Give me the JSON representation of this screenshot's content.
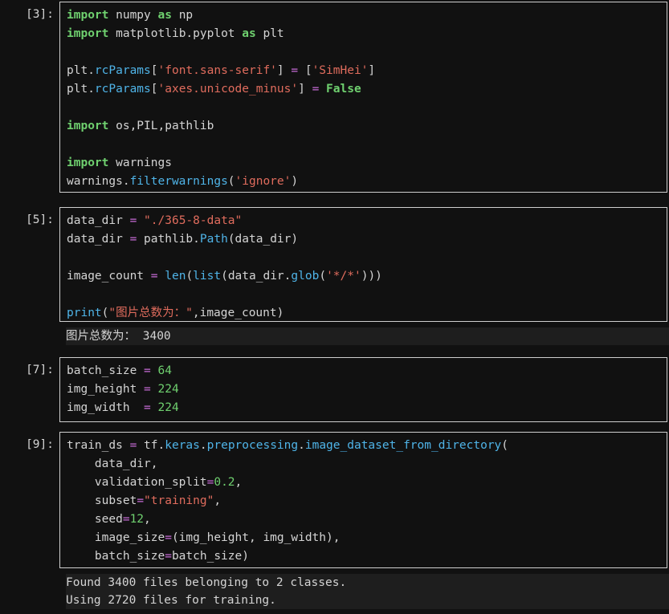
{
  "cells": [
    {
      "prompt": "[3]:",
      "lines": [
        [
          [
            "kw",
            "import"
          ],
          [
            "tx",
            " numpy "
          ],
          [
            "kw",
            "as"
          ],
          [
            "tx",
            " np"
          ]
        ],
        [
          [
            "kw",
            "import"
          ],
          [
            "tx",
            " matplotlib.pyplot "
          ],
          [
            "kw",
            "as"
          ],
          [
            "tx",
            " plt"
          ]
        ],
        [],
        [
          [
            "tx",
            "plt."
          ],
          [
            "fn",
            "rcParams"
          ],
          [
            "tx",
            "["
          ],
          [
            "str",
            "'font.sans-serif'"
          ],
          [
            "tx",
            "] "
          ],
          [
            "op",
            "="
          ],
          [
            "tx",
            " ["
          ],
          [
            "str",
            "'SimHei'"
          ],
          [
            "tx",
            "]"
          ]
        ],
        [
          [
            "tx",
            "plt."
          ],
          [
            "fn",
            "rcParams"
          ],
          [
            "tx",
            "["
          ],
          [
            "str",
            "'axes.unicode_minus'"
          ],
          [
            "tx",
            "] "
          ],
          [
            "op",
            "="
          ],
          [
            "tx",
            " "
          ],
          [
            "bool",
            "False"
          ]
        ],
        [],
        [
          [
            "kw",
            "import"
          ],
          [
            "tx",
            " os,PIL,pathlib"
          ]
        ],
        [],
        [
          [
            "kw",
            "import"
          ],
          [
            "tx",
            " warnings"
          ]
        ],
        [
          [
            "tx",
            "warnings."
          ],
          [
            "fn",
            "filterwarnings"
          ],
          [
            "tx",
            "("
          ],
          [
            "str",
            "'ignore'"
          ],
          [
            "tx",
            ")"
          ]
        ]
      ],
      "output": []
    },
    {
      "prompt": "[5]:",
      "lines": [
        [
          [
            "tx",
            "data_dir "
          ],
          [
            "op",
            "="
          ],
          [
            "tx",
            " "
          ],
          [
            "str",
            "\"./365-8-data\""
          ]
        ],
        [
          [
            "tx",
            "data_dir "
          ],
          [
            "op",
            "="
          ],
          [
            "tx",
            " pathlib."
          ],
          [
            "fn",
            "Path"
          ],
          [
            "tx",
            "(data_dir)"
          ]
        ],
        [],
        [
          [
            "tx",
            "image_count "
          ],
          [
            "op",
            "="
          ],
          [
            "tx",
            " "
          ],
          [
            "fn",
            "len"
          ],
          [
            "tx",
            "("
          ],
          [
            "fn",
            "list"
          ],
          [
            "tx",
            "(data_dir."
          ],
          [
            "fn",
            "glob"
          ],
          [
            "tx",
            "("
          ],
          [
            "str",
            "'*/*'"
          ],
          [
            "tx",
            ")))"
          ]
        ],
        [],
        [
          [
            "fn",
            "print"
          ],
          [
            "tx",
            "("
          ],
          [
            "str",
            "\"图片总数为：\""
          ],
          [
            "tx",
            ",image_count)"
          ]
        ]
      ],
      "output": [
        "图片总数为： 3400"
      ]
    },
    {
      "prompt": "[7]:",
      "lines": [
        [
          [
            "tx",
            "batch_size "
          ],
          [
            "op",
            "="
          ],
          [
            "tx",
            " "
          ],
          [
            "num",
            "64"
          ]
        ],
        [
          [
            "tx",
            "img_height "
          ],
          [
            "op",
            "="
          ],
          [
            "tx",
            " "
          ],
          [
            "num",
            "224"
          ]
        ],
        [
          [
            "tx",
            "img_width  "
          ],
          [
            "op",
            "="
          ],
          [
            "tx",
            " "
          ],
          [
            "num",
            "224"
          ]
        ]
      ],
      "output": []
    },
    {
      "prompt": "[9]:",
      "lines": [
        [
          [
            "tx",
            "train_ds "
          ],
          [
            "op",
            "="
          ],
          [
            "tx",
            " tf."
          ],
          [
            "fn",
            "keras"
          ],
          [
            "tx",
            "."
          ],
          [
            "fn",
            "preprocessing"
          ],
          [
            "tx",
            "."
          ],
          [
            "fn",
            "image_dataset_from_directory"
          ],
          [
            "tx",
            "("
          ]
        ],
        [
          [
            "tx",
            "    data_dir,"
          ]
        ],
        [
          [
            "tx",
            "    validation_split"
          ],
          [
            "op",
            "="
          ],
          [
            "num",
            "0.2"
          ],
          [
            "tx",
            ","
          ]
        ],
        [
          [
            "tx",
            "    subset"
          ],
          [
            "op",
            "="
          ],
          [
            "str",
            "\"training\""
          ],
          [
            "tx",
            ","
          ]
        ],
        [
          [
            "tx",
            "    seed"
          ],
          [
            "op",
            "="
          ],
          [
            "num",
            "12"
          ],
          [
            "tx",
            ","
          ]
        ],
        [
          [
            "tx",
            "    image_size"
          ],
          [
            "op",
            "="
          ],
          [
            "tx",
            "(img_height, img_width),"
          ]
        ],
        [
          [
            "tx",
            "    batch_size"
          ],
          [
            "op",
            "="
          ],
          [
            "tx",
            "batch_size)"
          ]
        ]
      ],
      "output": [
        "Found 3400 files belonging to 2 classes.",
        "Using 2720 files for training."
      ]
    }
  ]
}
